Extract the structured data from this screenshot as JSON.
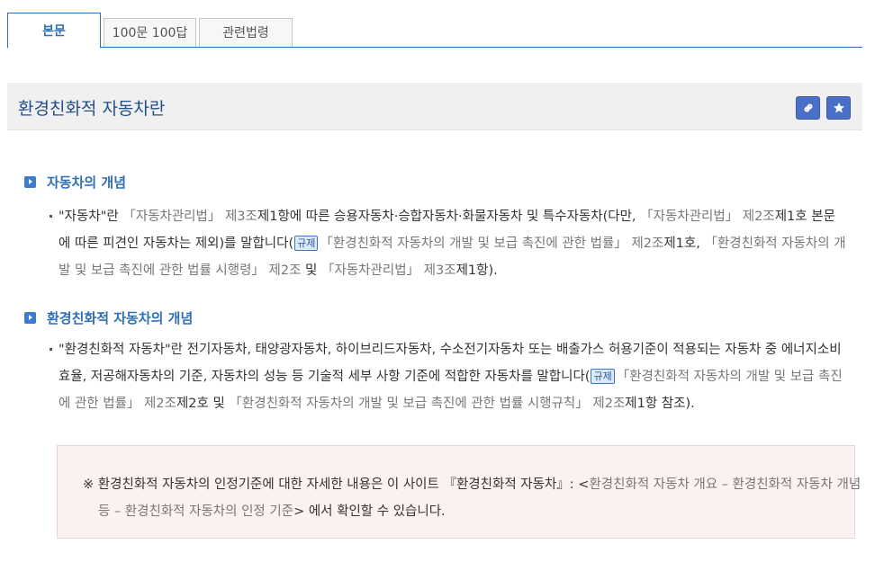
{
  "tabs": [
    {
      "label": "본문",
      "active": true
    },
    {
      "label": "100문 100답",
      "active": false
    },
    {
      "label": "관련법령",
      "active": false
    }
  ],
  "title": "환경친화적 자동차란",
  "icons": {
    "link": "link-icon",
    "favorite": "star-icon"
  },
  "colors": {
    "accent": "#2f6fb5",
    "title_bg": "#f0f0f0",
    "note_bg": "#fcf1f1",
    "badge_bg": "#dce9f7"
  },
  "sections": [
    {
      "heading": "자동차의 개념",
      "p": [
        "\"자동차\"란 ",
        "「자동차관리법」 제3조",
        "제1항에 따른 승용자동차·승합자동차·화물자동차 및 특수자동차(다만, ",
        "「자동차관리법」 제2조",
        "제1호 본문에 따른 피견인 자동차는 제외)를 말합니다(",
        "규제",
        "「환경친화적 자동차의 개발 및 보급 촉진에 관한 법률」 제2조",
        "제1호, ",
        "「환경친화적 자동차의 개발 및 보급 촉진에 관한 법률 시행령」 제2조",
        " 및 ",
        "「자동차관리법」 제3조",
        "제1항)."
      ]
    },
    {
      "heading": "환경친화적 자동차의 개념",
      "p": [
        "\"환경친화적 자동차\"란 전기자동차, 태양광자동차, 하이브리드자동차, 수소전기자동차 또는 배출가스 허용기준이 적용되는 자동차 중 에너지소비효율, 저공해자동차의 기준, 자동차의 성능 등 기술적 세부 사항 기준에 적합한 자동차를 말합니다(",
        "규제",
        "「환경친화적 자동차의 개발 및 보급 촉진에 관한 법률」 제2조",
        "제2호 및 ",
        "「환경친화적 자동차의 개발 및 보급 촉진에 관한 법률 시행규칙」 제2조",
        "제1항 참조)."
      ]
    }
  ],
  "note": {
    "prefix": "※ 환경친화적 자동차의 인정기준에 대한 자세한 내용은 이 사이트 『환경친화적 자동차』: <",
    "link": "환경친화적 자동차 개요 – 환경친화적 자동차 개념 등 – 환경친화적 자동차의 인정 기준",
    "suffix": "> 에서 확인할 수 있습니다."
  }
}
